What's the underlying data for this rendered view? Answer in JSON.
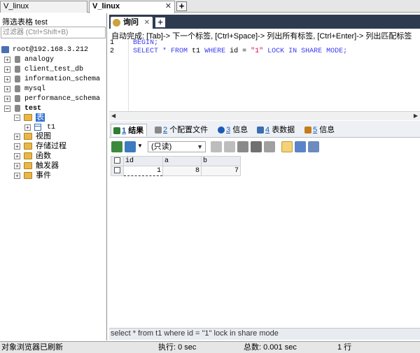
{
  "window_tabs": [
    {
      "label": "V_linux",
      "active": false
    },
    {
      "label": "V_linux",
      "active": true
    }
  ],
  "left_panel": {
    "filter_label": "筛选表格 test",
    "filter_placeholder": "过滤器 (Ctrl+Shift+B)",
    "server": "root@192.168.3.212",
    "databases": [
      "analogy",
      "client_test_db",
      "information_schema",
      "mysql",
      "performance_schema"
    ],
    "open_db": "test",
    "tables_folder": "表",
    "tables": [
      "t1"
    ],
    "folders": [
      "视图",
      "存储过程",
      "函数",
      "触发器",
      "事件"
    ]
  },
  "query_tab": {
    "label": "询问"
  },
  "editor": {
    "autocomplete_hint": "自动完成: [Tab]-> 下一个标签, [Ctrl+Space]-> 列出所有标签, [Ctrl+Enter]-> 列出匹配标签",
    "line_numbers": [
      "1",
      "2"
    ],
    "line1": {
      "kw": "BEGIN;"
    },
    "line2": {
      "kw1": "SELECT * FROM",
      "table": "t1",
      "kw2": "WHERE",
      "col": "id =",
      "val": "\"1\"",
      "kw3": "LOCK IN SHARE MODE;"
    }
  },
  "result_tabs": [
    {
      "num": "1",
      "label": "结果",
      "color": "#2f7d32"
    },
    {
      "num": "2",
      "label": "个配置文件",
      "color": "#888888"
    },
    {
      "num": "3",
      "label": "信息",
      "color": "#1b5bb8"
    },
    {
      "num": "4",
      "label": "表数据",
      "color": "#3b6db3"
    },
    {
      "num": "5",
      "label": "信息",
      "color": "#c47d1a"
    }
  ],
  "toolbar": {
    "mode_select": "(只读)"
  },
  "grid": {
    "columns": [
      "id",
      "a",
      "b"
    ],
    "rows": [
      [
        "1",
        "8",
        "7"
      ]
    ]
  },
  "sql_status": "select * from t1 where id = \"1\" lock in share mode",
  "statusbar": {
    "message": "对象浏览器已刷新",
    "exec_time": "执行: 0 sec",
    "total_time": "总数: 0.001 sec",
    "rows": "1 行"
  }
}
